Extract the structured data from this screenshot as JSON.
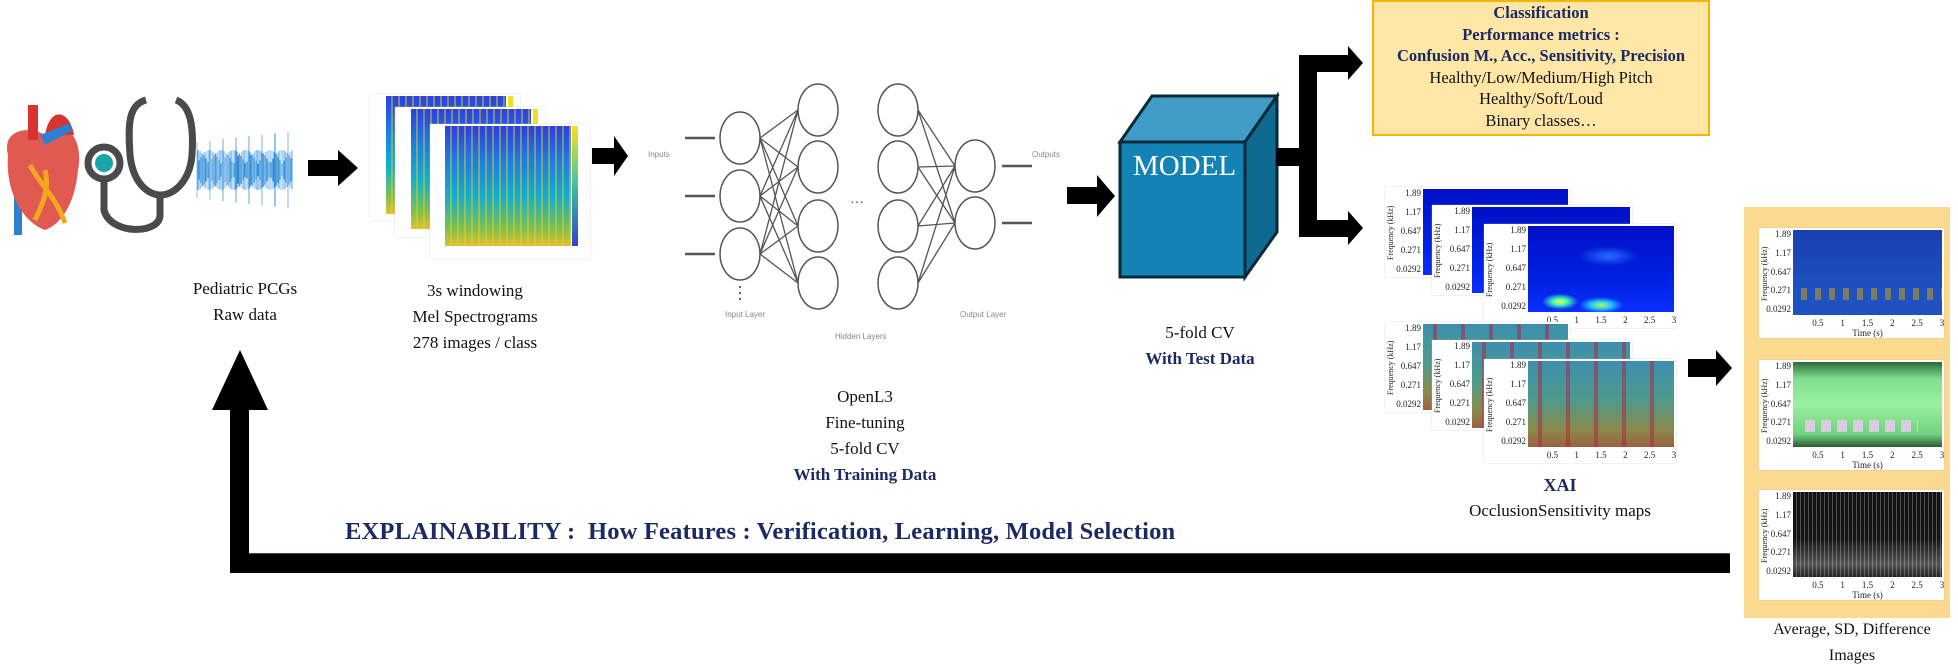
{
  "raw": {
    "line1": "Pediatric PCGs",
    "line2": "Raw data",
    "icons": [
      "heart-icon",
      "stethoscope-icon",
      "waveform-icon"
    ]
  },
  "spectro": {
    "line1": "3s windowing",
    "line2": "Mel Spectrograms",
    "line3": "278 images / class"
  },
  "nn": {
    "inputs": "Inputs",
    "outputs": "Outputs",
    "input_layer": "Input Layer",
    "hidden_layers": "Hidden Layers",
    "output_layer": "Output Layer",
    "ellipsis": "…",
    "line1": "OpenL3",
    "line2": "Fine-tuning",
    "line3": "5-fold CV",
    "line4": "With Training Data"
  },
  "model": {
    "label": "MODEL",
    "line1": "5-fold CV",
    "line2": "With Test Data",
    "color": "#1283b4"
  },
  "classification": {
    "title": "Classification",
    "metrics_title": "Performance metrics :",
    "metrics": "Confusion M., Acc., Sensitivity, Precision",
    "lines": [
      "Healthy/Low/Medium/High Pitch",
      "Healthy/Soft/Loud",
      "Binary classes…"
    ],
    "bg": "#fde6a6",
    "border": "#f5b400"
  },
  "xai": {
    "title": "XAI",
    "subtitle": "OcclusionSensitivity maps"
  },
  "plot_axes": {
    "ylabel": "Frequency (kHz)",
    "xlabel": "Time (s)",
    "yticks": [
      "1.89",
      "1.17",
      "0.647",
      "0.271",
      "0.0292"
    ],
    "xticks": [
      "0.5",
      "1",
      "1.5",
      "2",
      "2.5",
      "3"
    ]
  },
  "summary": {
    "line1": "Average, SD, Difference",
    "line2": "Images",
    "bg": "#fcd98e"
  },
  "explainability": {
    "text": "EXPLAINABILITY :  How Features : Verification, Learning, Model Selection",
    "color": "#1b2a63"
  }
}
